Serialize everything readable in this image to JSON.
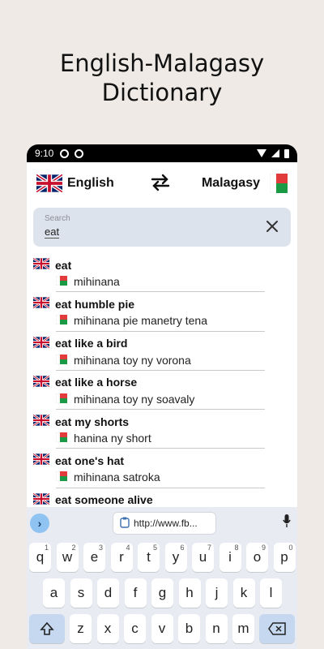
{
  "promo": {
    "line1": "English-Malagasy",
    "line2": "Dictionary"
  },
  "status": {
    "time": "9:10"
  },
  "langbar": {
    "source": "English",
    "target": "Malagasy"
  },
  "search": {
    "placeholder": "Search",
    "value": "eat"
  },
  "results": [
    {
      "term": "eat",
      "translation": "mihinana"
    },
    {
      "term": "eat humble pie",
      "translation": "mihinana pie manetry tena"
    },
    {
      "term": "eat like a bird",
      "translation": "mihinana toy ny vorona"
    },
    {
      "term": "eat like a horse",
      "translation": "mihinana toy ny soavaly"
    },
    {
      "term": "eat my shorts",
      "translation": "hanina ny short"
    },
    {
      "term": "eat one's hat",
      "translation": "mihinana satroka"
    },
    {
      "term": "eat someone alive",
      "translation": ""
    }
  ],
  "keyboard": {
    "url": "http://www.fb...",
    "row1": [
      {
        "k": "q",
        "n": "1"
      },
      {
        "k": "w",
        "n": "2"
      },
      {
        "k": "e",
        "n": "3"
      },
      {
        "k": "r",
        "n": "4"
      },
      {
        "k": "t",
        "n": "5"
      },
      {
        "k": "y",
        "n": "6"
      },
      {
        "k": "u",
        "n": "7"
      },
      {
        "k": "i",
        "n": "8"
      },
      {
        "k": "o",
        "n": "9"
      },
      {
        "k": "p",
        "n": "0"
      }
    ],
    "row2": [
      "a",
      "s",
      "d",
      "f",
      "g",
      "h",
      "j",
      "k",
      "l"
    ],
    "row3": [
      "z",
      "x",
      "c",
      "v",
      "b",
      "n",
      "m"
    ]
  }
}
